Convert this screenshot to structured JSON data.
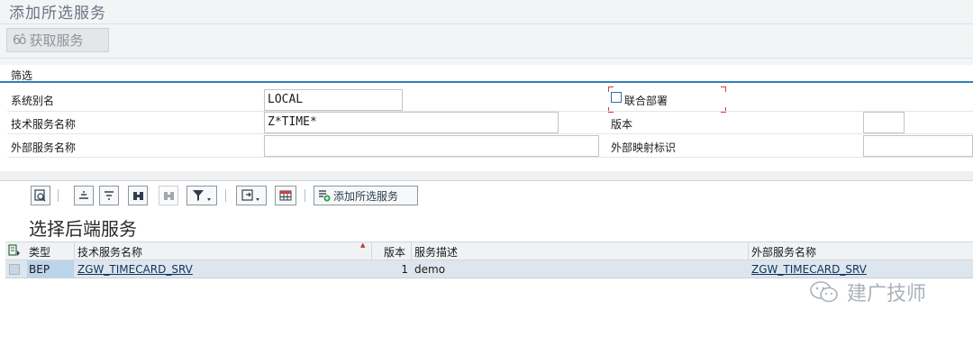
{
  "page": {
    "title": "添加所选服务"
  },
  "toolbar": {
    "fetch_label": "获取服务",
    "fetch_icon": "glasses-icon"
  },
  "filter": {
    "title": "筛选",
    "system_alias_label": "系统别名",
    "system_alias_value": "LOCAL",
    "tech_service_label": "技术服务名称",
    "tech_service_value": "Z*TIME*",
    "ext_service_label": "外部服务名称",
    "ext_service_value": "",
    "co_deploy_label": "联合部署",
    "version_label": "版本",
    "version_value": "",
    "ext_mapping_label": "外部映射标识",
    "ext_mapping_value": ""
  },
  "grid_toolbar": {
    "add_selected_label": "添加所选服务"
  },
  "section": {
    "title": "选择后端服务"
  },
  "table": {
    "columns": [
      "类型",
      "技术服务名称",
      "版本",
      "服务描述",
      "外部服务名称"
    ],
    "rows": [
      {
        "type": "BEP",
        "tech_name": "ZGW_TIMECARD_SRV",
        "version": "1",
        "description": "demo",
        "ext_name": "ZGW_TIMECARD_SRV"
      }
    ]
  },
  "watermark": {
    "text": "建广技师"
  },
  "colors": {
    "accent": "#2f80b8",
    "selected_row": "#dde6ee",
    "selected_cell": "#bcd4ea"
  }
}
